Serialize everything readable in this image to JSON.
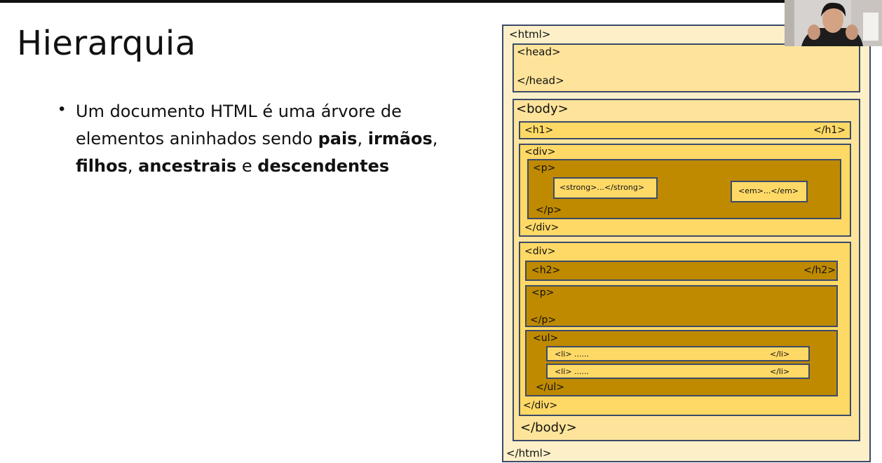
{
  "slide": {
    "title": "Hierarquia",
    "bullet": {
      "p1": "Um documento HTML é uma árvore de elementos aninhados sendo ",
      "b1": "pais",
      "p2": ", ",
      "b2": "irmãos",
      "p3": ", ",
      "b3": "filhos",
      "p4": ", ",
      "b4": "ancestrais",
      "p5": " e ",
      "b5": "descendentes"
    }
  },
  "diagram": {
    "html_open": "<html>",
    "html_close": "</html>",
    "head_open": "<head>",
    "head_close": "</head>",
    "body_open": "<body>",
    "body_close": "</body>",
    "h1_open": "<h1>",
    "h1_close": "</h1>",
    "div1_open": "<div>",
    "div1_close": "</div>",
    "p1_open": "<p>",
    "p1_close": "</p>",
    "strong": "<strong>...</strong>",
    "em": "<em>...</em>",
    "div2_open": "<div>",
    "div2_close": "</div>",
    "h2_open": "<h2>",
    "h2_close": "</h2>",
    "p2_open": "<p>",
    "p2_close": "</p>",
    "ul_open": "<ul>",
    "ul_close": "</ul>",
    "li1_open": "<li> ......",
    "li1_close": "</li>",
    "li2_open": "<li> ......",
    "li2_close": "</li>"
  },
  "colors": {
    "level1": "#fdf0c9",
    "level2": "#fee49a",
    "level3": "#ffd966",
    "level4": "#bf8a00",
    "border": "#3c4a68"
  }
}
